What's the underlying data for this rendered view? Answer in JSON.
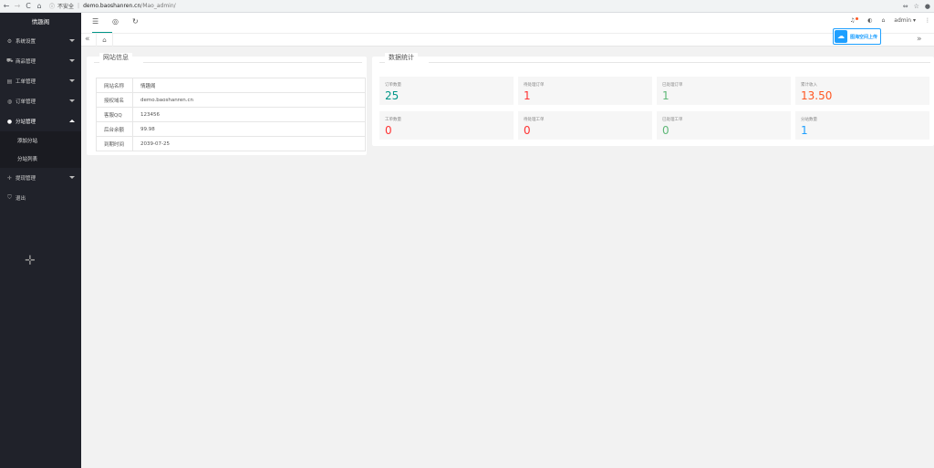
{
  "browser": {
    "security_label": "不安全",
    "url_domain": "demo.baoshanren.cn",
    "url_path": "/Mao_admin/"
  },
  "sidebar": {
    "logo": "情趣阁",
    "items": [
      {
        "label": "系统设置",
        "icon": "gear-icon"
      },
      {
        "label": "商品管理",
        "icon": "cart-icon"
      },
      {
        "label": "工单管理",
        "icon": "doc-icon"
      },
      {
        "label": "订单管理",
        "icon": "circle-icon"
      },
      {
        "label": "分站管理",
        "icon": "circle-icon"
      },
      {
        "label": "提现管理",
        "icon": "plus-icon"
      },
      {
        "label": "退出",
        "icon": "shield-icon"
      }
    ],
    "sub_items": [
      "添加分站",
      "分站列表"
    ]
  },
  "header": {
    "user": "admin",
    "upload_label": "图海空间上传"
  },
  "site_info": {
    "title": "网站信息",
    "rows": [
      {
        "key": "网站名称",
        "value": "情趣阁"
      },
      {
        "key": "授权域名",
        "value": "demo.baoshanren.cn"
      },
      {
        "key": "客服QQ",
        "value": "123456"
      },
      {
        "key": "后台余额",
        "value": "99.98"
      },
      {
        "key": "到期时间",
        "value": "2039-07-25"
      }
    ]
  },
  "stats": {
    "title": "数据统计",
    "cards": [
      {
        "label": "订单数量",
        "value": "25",
        "color": "#009688"
      },
      {
        "label": "待处理订单",
        "value": "1",
        "color": "#ff3333"
      },
      {
        "label": "已处理订单",
        "value": "1",
        "color": "#5fb878"
      },
      {
        "label": "累计收入",
        "value": "13.50",
        "color": "#ff5722"
      },
      {
        "label": "工单数量",
        "value": "0",
        "color": "#ff3333"
      },
      {
        "label": "待处理工单",
        "value": "0",
        "color": "#ff3333"
      },
      {
        "label": "已处理工单",
        "value": "0",
        "color": "#5fb878"
      },
      {
        "label": "分站数量",
        "value": "1",
        "color": "#1e9fff"
      }
    ]
  }
}
